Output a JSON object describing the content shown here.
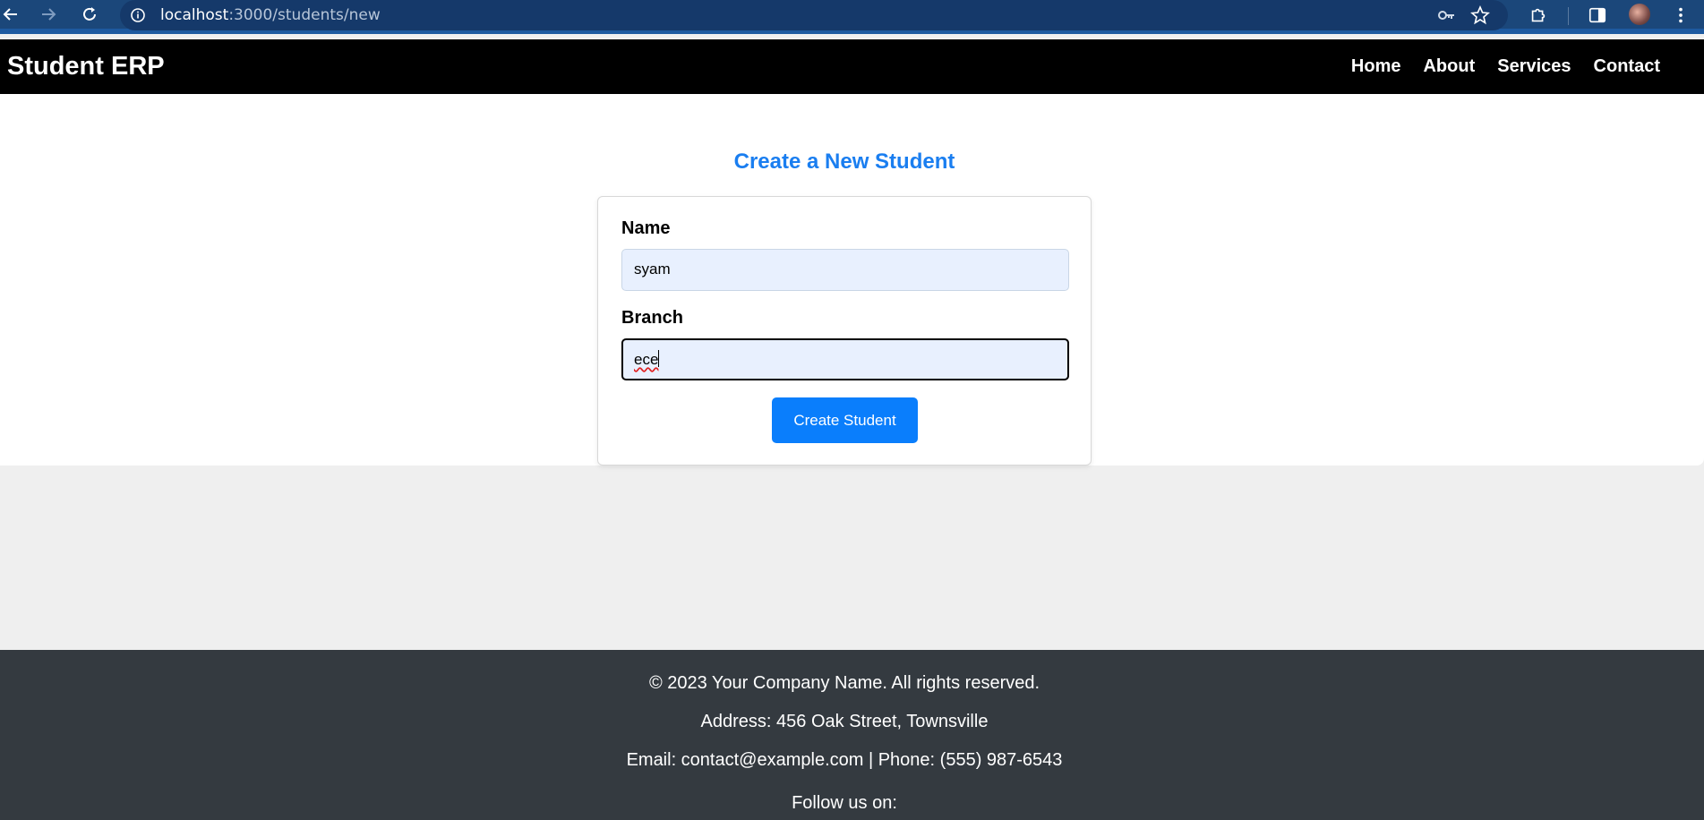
{
  "browser": {
    "url_host": "localhost",
    "url_path": ":3000/students/new"
  },
  "header": {
    "brand": "Student ERP",
    "nav": [
      "Home",
      "About",
      "Services",
      "Contact"
    ]
  },
  "form": {
    "title": "Create a New Student",
    "name_label": "Name",
    "name_value": "syam",
    "branch_label": "Branch",
    "branch_value": "ece",
    "submit_label": "Create Student"
  },
  "footer": {
    "copyright": "© 2023 Your Company Name. All rights reserved.",
    "address": "Address: 456 Oak Street, Townsville",
    "contact": "Email: contact@example.com | Phone: (555) 987-6543",
    "follow": "Follow us on:"
  },
  "colors": {
    "accent": "#1a7ef0",
    "button": "#0a7efc",
    "header_bg": "#000000",
    "footer_bg": "#343a40",
    "browser_bg": "#1b477a"
  }
}
